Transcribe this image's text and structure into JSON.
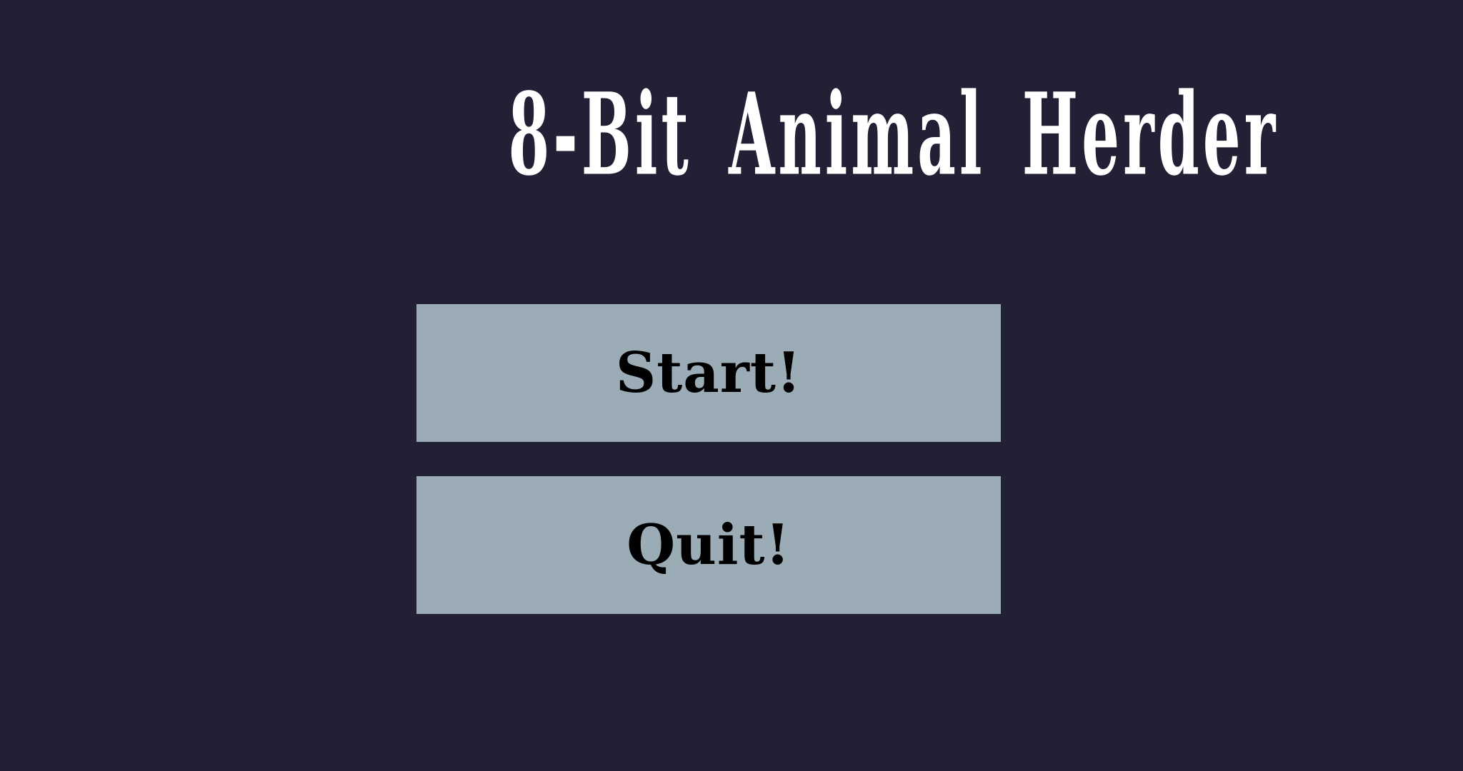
{
  "title": "8-Bit Animal Herder",
  "menu": {
    "start_label": "Start!",
    "quit_label": "Quit!"
  },
  "colors": {
    "background": "#212035",
    "title_text": "#ffffff",
    "button_fill": "#9bacb6",
    "button_text": "#000000"
  }
}
